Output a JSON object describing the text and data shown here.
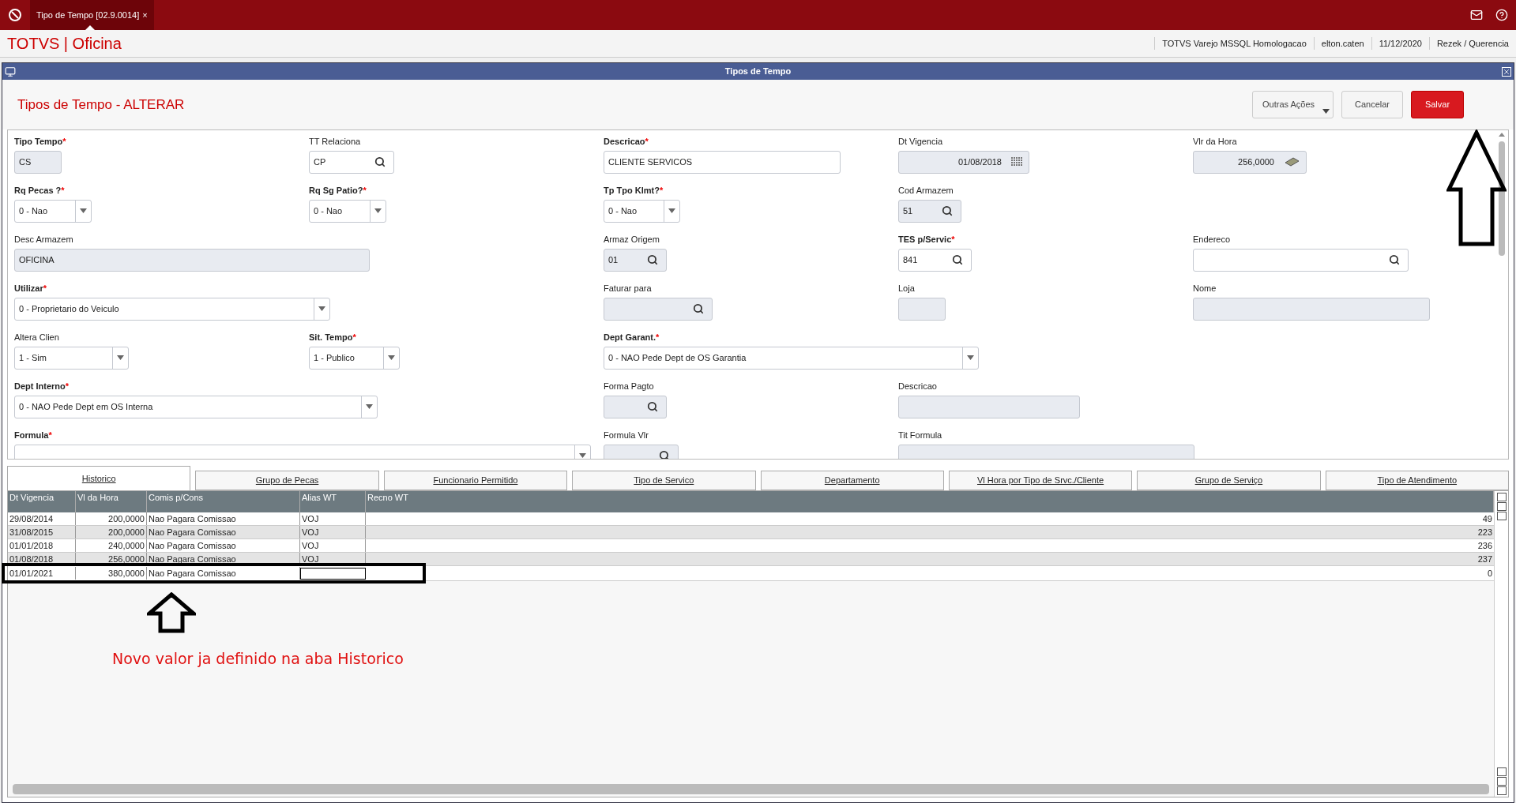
{
  "top_bar": {
    "tab": {
      "label": "Tipo de Tempo [02.9.0014]",
      "close": "×",
      "selected": true
    }
  },
  "header": {
    "brand": "TOTVS | Oficina",
    "info": [
      "TOTVS Varejo MSSQL Homologacao",
      "elton.caten",
      "11/12/2020",
      "Rezek / Querencia"
    ]
  },
  "window": {
    "title": "Tipos de Tempo",
    "heading": "Tipos de Tempo - ALTERAR",
    "buttons": [
      {
        "label": "Outras Ações",
        "kind": "menu"
      },
      {
        "label": "Cancelar",
        "kind": "plain"
      },
      {
        "label": "Salvar",
        "kind": "primary"
      }
    ]
  },
  "form": {
    "rows": [
      [
        {
          "label": "Tipo Tempo",
          "required_mark": "*",
          "kind": "text",
          "value": "CS",
          "disabled": true
        },
        {
          "label": "TT Relaciona",
          "kind": "lookup",
          "value": "CP",
          "disabled": false
        },
        {
          "label": "Descricao",
          "required_mark": "*",
          "kind": "text",
          "value": "CLIENTE SERVICOS",
          "disabled": false
        },
        {
          "label": "Dt Vigencia",
          "kind": "date",
          "value": "01/08/2018",
          "disabled": true
        },
        {
          "label": "Vlr da Hora",
          "kind": "money",
          "value": "256,0000",
          "disabled": true
        }
      ],
      [
        {
          "label": "Rq Pecas ?",
          "required_mark": "*",
          "kind": "select",
          "value": "0 - Nao",
          "disabled": false
        },
        {
          "label": "Rq Sg Patio?",
          "required_mark": "*",
          "kind": "select",
          "value": "0 - Nao",
          "disabled": false
        },
        {
          "label": "Tp Tpo Klmt?",
          "required_mark": "*",
          "kind": "select",
          "value": "0 - Nao",
          "disabled": false
        },
        {
          "label": "Cod Armazem",
          "kind": "lookup",
          "value": "51",
          "disabled": true
        }
      ],
      [
        {
          "label": "Desc Armazem",
          "kind": "text",
          "value": "OFICINA",
          "disabled": true
        },
        {
          "label": "Armaz Origem",
          "kind": "lookup",
          "value": "01",
          "disabled": true
        },
        {
          "label": "TES p/Servic",
          "required_mark": "*",
          "kind": "lookup",
          "value": "841",
          "disabled": false
        },
        {
          "label": "Endereco",
          "kind": "lookup",
          "disabled": false
        }
      ],
      [
        {
          "label": "Utilizar",
          "required_mark": "*",
          "kind": "select",
          "value": "0 - Proprietario do Veiculo",
          "disabled": false
        },
        {
          "label": "Faturar para",
          "kind": "lookup",
          "disabled": true
        },
        {
          "label": "Loja",
          "kind": "text",
          "disabled": true
        },
        {
          "label": "Nome",
          "kind": "text",
          "disabled": true
        }
      ],
      [
        {
          "label": "Altera Clien",
          "kind": "select",
          "value": "1 - Sim",
          "disabled": false
        },
        {
          "label": "Sit. Tempo",
          "required_mark": "*",
          "kind": "select",
          "value": "1 - Publico",
          "disabled": false
        },
        {
          "label": "Dept Garant.",
          "required_mark": "*",
          "kind": "select",
          "value": "0 - NAO Pede Dept de OS Garantia",
          "disabled": false
        }
      ],
      [
        {
          "label": "Dept Interno",
          "required_mark": "*",
          "kind": "select",
          "value": "0 - NAO Pede Dept em OS Interna",
          "disabled": false
        },
        {
          "label": "Forma Pagto",
          "kind": "lookup",
          "disabled": true
        },
        {
          "label": "Descricao",
          "kind": "text",
          "disabled": true
        }
      ],
      [
        {
          "label": "Formula",
          "required_mark": "*",
          "kind": "select",
          "disabled": false
        },
        {
          "label": "Formula Vlr",
          "kind": "lookup",
          "disabled": true
        },
        {
          "label": "Tit Formula",
          "kind": "text",
          "disabled": true
        }
      ]
    ]
  },
  "tabs": [
    {
      "label": "Historico",
      "selected": true
    },
    {
      "label": "Grupo de Pecas",
      "selected": false
    },
    {
      "label": "Funcionario Permitido",
      "selected": false
    },
    {
      "label": "Tipo de Servico",
      "selected": false
    },
    {
      "label": "Departamento",
      "selected": false
    },
    {
      "label": "Vl Hora por Tipo de Srvc./Cliente",
      "selected": false
    },
    {
      "label": "Grupo de Serviço",
      "selected": false
    },
    {
      "label": "Tipo de Atendimento",
      "selected": false
    }
  ],
  "table": {
    "columns": [
      "Dt Vigencia",
      "Vl da Hora",
      "Comis p/Cons",
      "Alias WT",
      "Recno WT"
    ],
    "rows": [
      {
        "cells": [
          "29/08/2014",
          "200,0000",
          "Nao Pagara Comissao",
          "VOJ",
          "49"
        ],
        "editing": false
      },
      {
        "cells": [
          "31/08/2015",
          "200,0000",
          "Nao Pagara Comissao",
          "VOJ",
          "223"
        ],
        "editing": false
      },
      {
        "cells": [
          "01/01/2018",
          "240,0000",
          "Nao Pagara Comissao",
          "VOJ",
          "236"
        ],
        "editing": false
      },
      {
        "cells": [
          "01/08/2018",
          "256,0000",
          "Nao Pagara Comissao",
          "VOJ",
          "237"
        ],
        "editing": false
      },
      {
        "cells": [
          "01/01/2021",
          "380,0000",
          "Nao Pagara Comissao",
          "",
          "0"
        ],
        "editing": true
      }
    ]
  },
  "annotation": {
    "text": "Novo valor ja definido na aba Historico"
  }
}
